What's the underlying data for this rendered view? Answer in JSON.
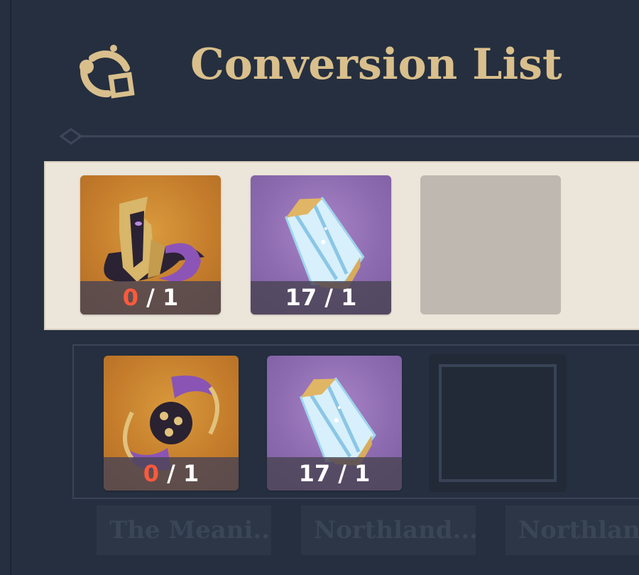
{
  "header": {
    "title": "Conversion List",
    "icon": "conversion-icon"
  },
  "colors": {
    "background": "#252f3f",
    "title_gold": "#d9bf8c",
    "selected_row": "#ece5da",
    "deficit_red": "#ff5a3c",
    "rarity_orange": "#c57d2c",
    "rarity_purple": "#8d6bb0"
  },
  "rows": [
    {
      "selected": true,
      "items": [
        {
          "icon": "gold-purple-mask-artifact-icon",
          "rarity": "orange",
          "have": "0",
          "need": "1",
          "deficit": true
        },
        {
          "icon": "blue-crystal-icon",
          "rarity": "purple",
          "have": "17",
          "need": "1",
          "deficit": false
        }
      ]
    },
    {
      "selected": false,
      "items": [
        {
          "icon": "purple-orb-crescent-icon",
          "rarity": "orange",
          "have": "0",
          "need": "1",
          "deficit": true
        },
        {
          "icon": "blue-crystal-icon",
          "rarity": "purple",
          "have": "17",
          "need": "1",
          "deficit": false
        }
      ]
    }
  ],
  "tabs": [
    {
      "label": "The Meani..."
    },
    {
      "label": "Northland..."
    },
    {
      "label": "Northlan"
    }
  ]
}
